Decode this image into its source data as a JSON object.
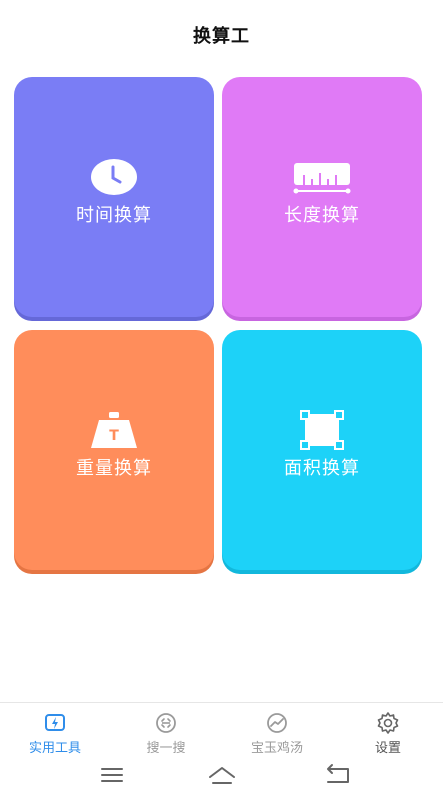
{
  "header": {
    "title": "换算工"
  },
  "cards": [
    {
      "label": "时间换算",
      "icon": "clock-icon",
      "color": "#7a7df5"
    },
    {
      "label": "长度换算",
      "icon": "ruler-icon",
      "color": "#e07af6"
    },
    {
      "label": "重量换算",
      "icon": "weight-icon",
      "color": "#ff8d5b"
    },
    {
      "label": "面积换算",
      "icon": "area-icon",
      "color": "#1dd2f8"
    }
  ],
  "tabs": [
    {
      "label": "实用工具",
      "icon": "tools-icon",
      "active": true
    },
    {
      "label": "搜一搜",
      "icon": "scan-search-icon",
      "active": false
    },
    {
      "label": "宝玉鸡汤",
      "icon": "trend-icon",
      "active": false
    },
    {
      "label": "设置",
      "icon": "gear-icon",
      "active": false
    }
  ],
  "colors": {
    "accent": "#2f8dea",
    "inactive": "#9a9a9a"
  }
}
